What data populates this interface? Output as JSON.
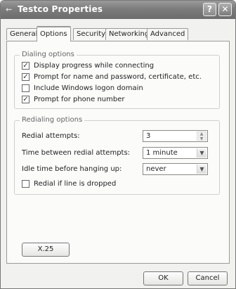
{
  "window": {
    "title": "Testco Properties",
    "help_label": "?",
    "close_label": "✕",
    "icon_glyph": "⇜"
  },
  "tabs": [
    {
      "label": "General",
      "active": false
    },
    {
      "label": "Options",
      "active": true
    },
    {
      "label": "Security",
      "active": false
    },
    {
      "label": "Networking",
      "active": false
    },
    {
      "label": "Advanced",
      "active": false
    }
  ],
  "dialing": {
    "group_title": "Dialing options",
    "items": [
      {
        "label": "Display progress while connecting",
        "checked": true
      },
      {
        "label": "Prompt for name and password, certificate, etc.",
        "checked": true
      },
      {
        "label": "Include Windows logon domain",
        "checked": false
      },
      {
        "label": "Prompt for phone number",
        "checked": true
      }
    ]
  },
  "redialing": {
    "group_title": "Redialing options",
    "attempts_label": "Redial attempts:",
    "attempts_value": "3",
    "between_label": "Time between redial attempts:",
    "between_value": "1 minute",
    "idle_label": "Idle time before hanging up:",
    "idle_value": "never",
    "redial_drop_label": "Redial if line is dropped",
    "redial_drop_checked": false
  },
  "buttons": {
    "x25": "X.25",
    "ok": "OK",
    "cancel": "Cancel"
  },
  "glyphs": {
    "check": "✓",
    "spin_up": "▲",
    "spin_down": "▼",
    "dropdown": "▼"
  }
}
